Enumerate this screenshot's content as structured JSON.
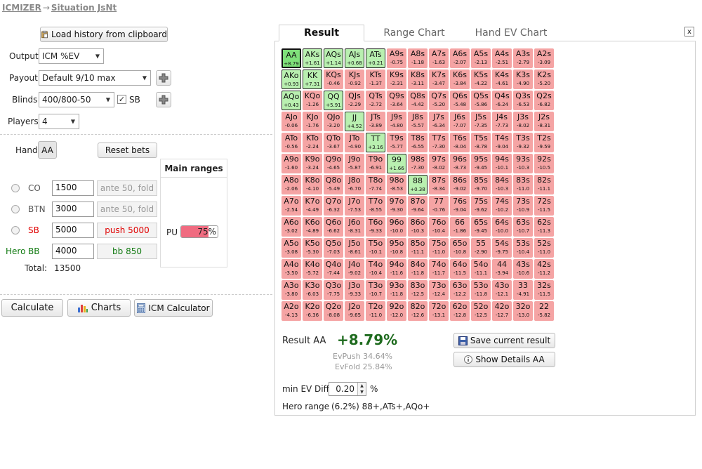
{
  "breadcrumb": {
    "root": "ICMIZER",
    "arrow": "→",
    "current": "Situation JsNt"
  },
  "controls": {
    "load_history": "Load history from clipboard",
    "output_label": "Output",
    "output_value": "ICM %EV",
    "payout_label": "Payout",
    "payout_value": "Default 9/10 max",
    "blinds_label": "Blinds",
    "blinds_value": "400/800-50",
    "sb_label": "SB",
    "players_label": "Players",
    "players_value": "4",
    "hand_label": "Hand",
    "hand_value": "AA",
    "reset_bets": "Reset bets"
  },
  "players": [
    {
      "pos": "CO",
      "stack": "1500",
      "action": "ante 50, fold",
      "style": "grey"
    },
    {
      "pos": "BTN",
      "stack": "3000",
      "action": "ante 50, fold",
      "style": "grey"
    },
    {
      "pos": "SB",
      "stack": "5000",
      "action": "push 5000",
      "style": "red"
    },
    {
      "pos": "BB",
      "hero": "Hero",
      "stack": "4000",
      "action": "bb 850",
      "style": "green"
    }
  ],
  "total": {
    "label": "Total:",
    "value": "13500"
  },
  "main_ranges": {
    "title": "Main ranges",
    "player": "PU",
    "percent": "75%",
    "fraction": 0.75
  },
  "bottom_buttons": {
    "calculate": "Calculate",
    "charts": "Charts",
    "icm": "ICM Calculator"
  },
  "tabs": [
    "Result",
    "Range Chart",
    "Hand EV Chart"
  ],
  "close": "x",
  "grid": [
    [
      [
        "AA",
        "+8.79",
        "sel"
      ],
      [
        "AKs",
        "+1.61",
        "pos"
      ],
      [
        "AQs",
        "+1.14",
        "pos"
      ],
      [
        "AJs",
        "+0.68",
        "pos"
      ],
      [
        "ATs",
        "+0.21",
        "pos"
      ],
      [
        "A9s",
        "-0.75",
        "neg"
      ],
      [
        "A8s",
        "-1.18",
        "neg"
      ],
      [
        "A7s",
        "-1.63",
        "neg"
      ],
      [
        "A6s",
        "-2.07",
        "neg"
      ],
      [
        "A5s",
        "-2.13",
        "neg"
      ],
      [
        "A4s",
        "-2.51",
        "neg"
      ],
      [
        "A3s",
        "-2.79",
        "neg"
      ],
      [
        "A2s",
        "-3.09",
        "neg"
      ]
    ],
    [
      [
        "AKo",
        "+0.93",
        "pos"
      ],
      [
        "KK",
        "+7.31",
        "pos"
      ],
      [
        "KQs",
        "-0.46",
        "neg"
      ],
      [
        "KJs",
        "-0.92",
        "neg"
      ],
      [
        "KTs",
        "-1.37",
        "neg"
      ],
      [
        "K9s",
        "-2.31",
        "neg"
      ],
      [
        "K8s",
        "-3.11",
        "neg"
      ],
      [
        "K7s",
        "-3.47",
        "neg"
      ],
      [
        "K6s",
        "-3.84",
        "neg"
      ],
      [
        "K5s",
        "-4.22",
        "neg"
      ],
      [
        "K4s",
        "-4.61",
        "neg"
      ],
      [
        "K3s",
        "-4.90",
        "neg"
      ],
      [
        "K2s",
        "-5.20",
        "neg"
      ]
    ],
    [
      [
        "AQo",
        "+0.43",
        "pos"
      ],
      [
        "KQo",
        "-1.26",
        "neg"
      ],
      [
        "QQ",
        "+5.91",
        "pos"
      ],
      [
        "QJs",
        "-2.29",
        "neg"
      ],
      [
        "QTs",
        "-2.72",
        "neg"
      ],
      [
        "Q9s",
        "-3.64",
        "neg"
      ],
      [
        "Q8s",
        "-4.42",
        "neg"
      ],
      [
        "Q7s",
        "-5.20",
        "neg"
      ],
      [
        "Q6s",
        "-5.48",
        "neg"
      ],
      [
        "Q5s",
        "-5.86",
        "neg"
      ],
      [
        "Q4s",
        "-6.24",
        "neg"
      ],
      [
        "Q3s",
        "-6.53",
        "neg"
      ],
      [
        "Q2s",
        "-6.82",
        "neg"
      ]
    ],
    [
      [
        "AJo",
        "-0.06",
        "neg"
      ],
      [
        "KJo",
        "-1.76",
        "neg"
      ],
      [
        "QJo",
        "-3.20",
        "neg"
      ],
      [
        "JJ",
        "+4.52",
        "pos"
      ],
      [
        "JTs",
        "-3.89",
        "neg"
      ],
      [
        "J9s",
        "-4.80",
        "neg"
      ],
      [
        "J8s",
        "-5.57",
        "neg"
      ],
      [
        "J7s",
        "-6.34",
        "neg"
      ],
      [
        "J6s",
        "-7.07",
        "neg"
      ],
      [
        "J5s",
        "-7.35",
        "neg"
      ],
      [
        "J4s",
        "-7.73",
        "neg"
      ],
      [
        "J3s",
        "-8.02",
        "neg"
      ],
      [
        "J2s",
        "-8.31",
        "neg"
      ]
    ],
    [
      [
        "ATo",
        "-0.56",
        "neg"
      ],
      [
        "KTo",
        "-2.24",
        "neg"
      ],
      [
        "QTo",
        "-3.67",
        "neg"
      ],
      [
        "JTo",
        "-4.90",
        "neg"
      ],
      [
        "TT",
        "+3.16",
        "pos"
      ],
      [
        "T9s",
        "-5.77",
        "neg"
      ],
      [
        "T8s",
        "-6.55",
        "neg"
      ],
      [
        "T7s",
        "-7.30",
        "neg"
      ],
      [
        "T6s",
        "-8.04",
        "neg"
      ],
      [
        "T5s",
        "-8.78",
        "neg"
      ],
      [
        "T4s",
        "-9.04",
        "neg"
      ],
      [
        "T3s",
        "-9.32",
        "neg"
      ],
      [
        "T2s",
        "-9.59",
        "neg"
      ]
    ],
    [
      [
        "A9o",
        "-1.60",
        "neg"
      ],
      [
        "K9o",
        "-3.24",
        "neg"
      ],
      [
        "Q9o",
        "-4.65",
        "neg"
      ],
      [
        "J9o",
        "-5.87",
        "neg"
      ],
      [
        "T9o",
        "-6.91",
        "neg"
      ],
      [
        "99",
        "+1.66",
        "pos"
      ],
      [
        "98s",
        "-7.30",
        "neg"
      ],
      [
        "97s",
        "-8.02",
        "neg"
      ],
      [
        "96s",
        "-8.73",
        "neg"
      ],
      [
        "95s",
        "-9.45",
        "neg"
      ],
      [
        "94s",
        "-10.1",
        "neg"
      ],
      [
        "93s",
        "-10.3",
        "neg"
      ],
      [
        "92s",
        "-10.5",
        "neg"
      ]
    ],
    [
      [
        "A8o",
        "-2.06",
        "neg"
      ],
      [
        "K8o",
        "-4.10",
        "neg"
      ],
      [
        "Q8o",
        "-5.49",
        "neg"
      ],
      [
        "J8o",
        "-6.70",
        "neg"
      ],
      [
        "T8o",
        "-7.74",
        "neg"
      ],
      [
        "98o",
        "-8.53",
        "neg"
      ],
      [
        "88",
        "+0.38",
        "pos"
      ],
      [
        "87s",
        "-8.34",
        "neg"
      ],
      [
        "86s",
        "-9.02",
        "neg"
      ],
      [
        "85s",
        "-9.70",
        "neg"
      ],
      [
        "84s",
        "-10.3",
        "neg"
      ],
      [
        "83s",
        "-11.0",
        "neg"
      ],
      [
        "82s",
        "-11.1",
        "neg"
      ]
    ],
    [
      [
        "A7o",
        "-2.54",
        "neg"
      ],
      [
        "K7o",
        "-4.49",
        "neg"
      ],
      [
        "Q7o",
        "-6.32",
        "neg"
      ],
      [
        "J7o",
        "-7.53",
        "neg"
      ],
      [
        "T7o",
        "-8.55",
        "neg"
      ],
      [
        "97o",
        "-9.30",
        "neg"
      ],
      [
        "87o",
        "-9.64",
        "neg"
      ],
      [
        "77",
        "-0.76",
        "neg"
      ],
      [
        "76s",
        "-9.04",
        "neg"
      ],
      [
        "75s",
        "-9.62",
        "neg"
      ],
      [
        "74s",
        "-10.2",
        "neg"
      ],
      [
        "73s",
        "-10.9",
        "neg"
      ],
      [
        "72s",
        "-11.5",
        "neg"
      ]
    ],
    [
      [
        "A6o",
        "-3.02",
        "neg"
      ],
      [
        "K6o",
        "-4.89",
        "neg"
      ],
      [
        "Q6o",
        "-6.62",
        "neg"
      ],
      [
        "J6o",
        "-8.31",
        "neg"
      ],
      [
        "T6o",
        "-9.33",
        "neg"
      ],
      [
        "96o",
        "-10.0",
        "neg"
      ],
      [
        "86o",
        "-10.3",
        "neg"
      ],
      [
        "76o",
        "-10.4",
        "neg"
      ],
      [
        "66",
        "-1.86",
        "neg"
      ],
      [
        "65s",
        "-9.45",
        "neg"
      ],
      [
        "64s",
        "-10.0",
        "neg"
      ],
      [
        "63s",
        "-10.7",
        "neg"
      ],
      [
        "62s",
        "-11.3",
        "neg"
      ]
    ],
    [
      [
        "A5o",
        "-3.08",
        "neg"
      ],
      [
        "K5o",
        "-5.30",
        "neg"
      ],
      [
        "Q5o",
        "-7.03",
        "neg"
      ],
      [
        "J5o",
        "-8.61",
        "neg"
      ],
      [
        "T5o",
        "-10.1",
        "neg"
      ],
      [
        "95o",
        "-10.8",
        "neg"
      ],
      [
        "85o",
        "-11.1",
        "neg"
      ],
      [
        "75o",
        "-11.0",
        "neg"
      ],
      [
        "65o",
        "-10.8",
        "neg"
      ],
      [
        "55",
        "-2.90",
        "neg"
      ],
      [
        "54s",
        "-9.75",
        "neg"
      ],
      [
        "53s",
        "-10.4",
        "neg"
      ],
      [
        "52s",
        "-11.0",
        "neg"
      ]
    ],
    [
      [
        "A4o",
        "-3.50",
        "neg"
      ],
      [
        "K4o",
        "-5.72",
        "neg"
      ],
      [
        "Q4o",
        "-7.44",
        "neg"
      ],
      [
        "J4o",
        "-9.02",
        "neg"
      ],
      [
        "T4o",
        "-10.4",
        "neg"
      ],
      [
        "94o",
        "-11.6",
        "neg"
      ],
      [
        "84o",
        "-11.8",
        "neg"
      ],
      [
        "74o",
        "-11.7",
        "neg"
      ],
      [
        "64o",
        "-11.5",
        "neg"
      ],
      [
        "54o",
        "-11.1",
        "neg"
      ],
      [
        "44",
        "-3.94",
        "neg"
      ],
      [
        "43s",
        "-10.6",
        "neg"
      ],
      [
        "42s",
        "-11.2",
        "neg"
      ]
    ],
    [
      [
        "A3o",
        "-3.80",
        "neg"
      ],
      [
        "K3o",
        "-6.03",
        "neg"
      ],
      [
        "Q3o",
        "-7.75",
        "neg"
      ],
      [
        "J3o",
        "-9.33",
        "neg"
      ],
      [
        "T3o",
        "-10.7",
        "neg"
      ],
      [
        "93o",
        "-11.8",
        "neg"
      ],
      [
        "83o",
        "-12.5",
        "neg"
      ],
      [
        "73o",
        "-12.4",
        "neg"
      ],
      [
        "63o",
        "-12.2",
        "neg"
      ],
      [
        "53o",
        "-11.8",
        "neg"
      ],
      [
        "43o",
        "-12.1",
        "neg"
      ],
      [
        "33",
        "-4.91",
        "neg"
      ],
      [
        "32s",
        "-11.5",
        "neg"
      ]
    ],
    [
      [
        "A2o",
        "-4.13",
        "neg"
      ],
      [
        "K2o",
        "-6.36",
        "neg"
      ],
      [
        "Q2o",
        "-8.08",
        "neg"
      ],
      [
        "J2o",
        "-9.65",
        "neg"
      ],
      [
        "T2o",
        "-11.0",
        "neg"
      ],
      [
        "92o",
        "-12.0",
        "neg"
      ],
      [
        "82o",
        "-12.6",
        "neg"
      ],
      [
        "72o",
        "-13.1",
        "neg"
      ],
      [
        "62o",
        "-12.8",
        "neg"
      ],
      [
        "52o",
        "-12.5",
        "neg"
      ],
      [
        "42o",
        "-12.7",
        "neg"
      ],
      [
        "32o",
        "-13.0",
        "neg"
      ],
      [
        "22",
        "-5.82",
        "neg"
      ]
    ]
  ],
  "result": {
    "label": "Result AA",
    "value": "+8.79%",
    "ev_push": "EvPush 34.64%",
    "ev_fold": "EvFold 25.84%",
    "save": "Save current result",
    "details": "Show Details AA",
    "min_ev_label": "min EV Diff",
    "min_ev_value": "0.20",
    "min_ev_unit": "%",
    "hero_range_label": "Hero range",
    "hero_range_value": "(6.2%) 88+,ATs+,AQo+"
  },
  "colors": {
    "positive_cell": "#b9f0b0",
    "negative_cell": "#f5a4a4",
    "result_green": "#1e6b1e",
    "push_red": "#e00000"
  }
}
